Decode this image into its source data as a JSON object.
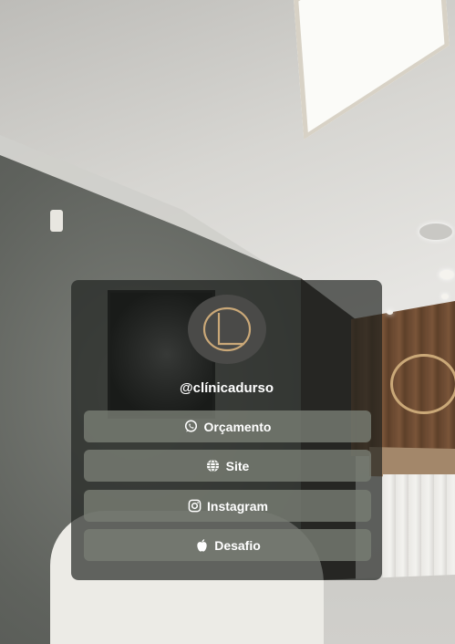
{
  "profile": {
    "handle": "@clínicadurso",
    "logo_icon": "dl-monogram-icon"
  },
  "links": [
    {
      "label": "Orçamento",
      "icon": "whatsapp-icon"
    },
    {
      "label": "Site",
      "icon": "globe-icon"
    },
    {
      "label": "Instagram",
      "icon": "instagram-icon"
    },
    {
      "label": "Desafio",
      "icon": "apple-icon"
    }
  ],
  "colors": {
    "card_background": "#1e201e",
    "button_background": "#787d73",
    "logo_gold": "#caa878",
    "text": "#ffffff"
  }
}
